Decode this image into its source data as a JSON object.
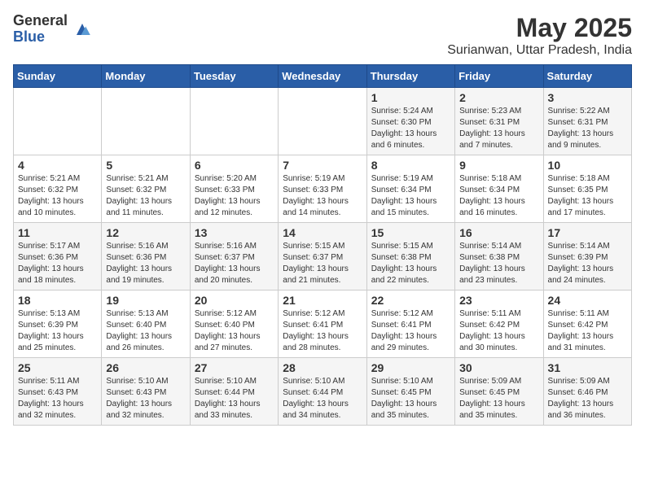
{
  "logo": {
    "general": "General",
    "blue": "Blue"
  },
  "title": "May 2025",
  "location": "Surianwan, Uttar Pradesh, India",
  "headers": [
    "Sunday",
    "Monday",
    "Tuesday",
    "Wednesday",
    "Thursday",
    "Friday",
    "Saturday"
  ],
  "weeks": [
    [
      {
        "day": "",
        "content": ""
      },
      {
        "day": "",
        "content": ""
      },
      {
        "day": "",
        "content": ""
      },
      {
        "day": "",
        "content": ""
      },
      {
        "day": "1",
        "content": "Sunrise: 5:24 AM\nSunset: 6:30 PM\nDaylight: 13 hours and 6 minutes."
      },
      {
        "day": "2",
        "content": "Sunrise: 5:23 AM\nSunset: 6:31 PM\nDaylight: 13 hours and 7 minutes."
      },
      {
        "day": "3",
        "content": "Sunrise: 5:22 AM\nSunset: 6:31 PM\nDaylight: 13 hours and 9 minutes."
      }
    ],
    [
      {
        "day": "4",
        "content": "Sunrise: 5:21 AM\nSunset: 6:32 PM\nDaylight: 13 hours and 10 minutes."
      },
      {
        "day": "5",
        "content": "Sunrise: 5:21 AM\nSunset: 6:32 PM\nDaylight: 13 hours and 11 minutes."
      },
      {
        "day": "6",
        "content": "Sunrise: 5:20 AM\nSunset: 6:33 PM\nDaylight: 13 hours and 12 minutes."
      },
      {
        "day": "7",
        "content": "Sunrise: 5:19 AM\nSunset: 6:33 PM\nDaylight: 13 hours and 14 minutes."
      },
      {
        "day": "8",
        "content": "Sunrise: 5:19 AM\nSunset: 6:34 PM\nDaylight: 13 hours and 15 minutes."
      },
      {
        "day": "9",
        "content": "Sunrise: 5:18 AM\nSunset: 6:34 PM\nDaylight: 13 hours and 16 minutes."
      },
      {
        "day": "10",
        "content": "Sunrise: 5:18 AM\nSunset: 6:35 PM\nDaylight: 13 hours and 17 minutes."
      }
    ],
    [
      {
        "day": "11",
        "content": "Sunrise: 5:17 AM\nSunset: 6:36 PM\nDaylight: 13 hours and 18 minutes."
      },
      {
        "day": "12",
        "content": "Sunrise: 5:16 AM\nSunset: 6:36 PM\nDaylight: 13 hours and 19 minutes."
      },
      {
        "day": "13",
        "content": "Sunrise: 5:16 AM\nSunset: 6:37 PM\nDaylight: 13 hours and 20 minutes."
      },
      {
        "day": "14",
        "content": "Sunrise: 5:15 AM\nSunset: 6:37 PM\nDaylight: 13 hours and 21 minutes."
      },
      {
        "day": "15",
        "content": "Sunrise: 5:15 AM\nSunset: 6:38 PM\nDaylight: 13 hours and 22 minutes."
      },
      {
        "day": "16",
        "content": "Sunrise: 5:14 AM\nSunset: 6:38 PM\nDaylight: 13 hours and 23 minutes."
      },
      {
        "day": "17",
        "content": "Sunrise: 5:14 AM\nSunset: 6:39 PM\nDaylight: 13 hours and 24 minutes."
      }
    ],
    [
      {
        "day": "18",
        "content": "Sunrise: 5:13 AM\nSunset: 6:39 PM\nDaylight: 13 hours and 25 minutes."
      },
      {
        "day": "19",
        "content": "Sunrise: 5:13 AM\nSunset: 6:40 PM\nDaylight: 13 hours and 26 minutes."
      },
      {
        "day": "20",
        "content": "Sunrise: 5:12 AM\nSunset: 6:40 PM\nDaylight: 13 hours and 27 minutes."
      },
      {
        "day": "21",
        "content": "Sunrise: 5:12 AM\nSunset: 6:41 PM\nDaylight: 13 hours and 28 minutes."
      },
      {
        "day": "22",
        "content": "Sunrise: 5:12 AM\nSunset: 6:41 PM\nDaylight: 13 hours and 29 minutes."
      },
      {
        "day": "23",
        "content": "Sunrise: 5:11 AM\nSunset: 6:42 PM\nDaylight: 13 hours and 30 minutes."
      },
      {
        "day": "24",
        "content": "Sunrise: 5:11 AM\nSunset: 6:42 PM\nDaylight: 13 hours and 31 minutes."
      }
    ],
    [
      {
        "day": "25",
        "content": "Sunrise: 5:11 AM\nSunset: 6:43 PM\nDaylight: 13 hours and 32 minutes."
      },
      {
        "day": "26",
        "content": "Sunrise: 5:10 AM\nSunset: 6:43 PM\nDaylight: 13 hours and 32 minutes."
      },
      {
        "day": "27",
        "content": "Sunrise: 5:10 AM\nSunset: 6:44 PM\nDaylight: 13 hours and 33 minutes."
      },
      {
        "day": "28",
        "content": "Sunrise: 5:10 AM\nSunset: 6:44 PM\nDaylight: 13 hours and 34 minutes."
      },
      {
        "day": "29",
        "content": "Sunrise: 5:10 AM\nSunset: 6:45 PM\nDaylight: 13 hours and 35 minutes."
      },
      {
        "day": "30",
        "content": "Sunrise: 5:09 AM\nSunset: 6:45 PM\nDaylight: 13 hours and 35 minutes."
      },
      {
        "day": "31",
        "content": "Sunrise: 5:09 AM\nSunset: 6:46 PM\nDaylight: 13 hours and 36 minutes."
      }
    ]
  ]
}
